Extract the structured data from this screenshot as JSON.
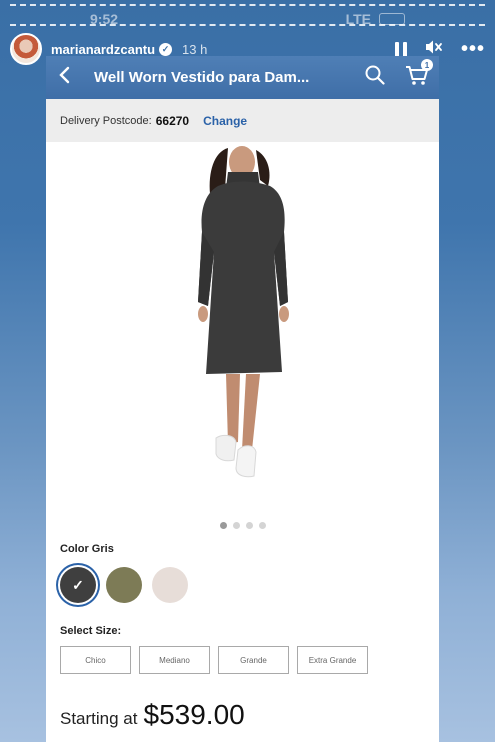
{
  "status": {
    "time": "9:52",
    "signal": "LTE"
  },
  "story": {
    "username": "marianardzcantu",
    "time_ago": "13 h"
  },
  "app": {
    "title": "Well Worn Vestido para Dam...",
    "cart_count": "1",
    "delivery_label": "Delivery Postcode:",
    "postcode": "66270",
    "change_label": "Change"
  },
  "product": {
    "image_pages": 4,
    "active_page": 1,
    "color_label": "Color",
    "color_value": "Gris",
    "colors": [
      {
        "name": "gris",
        "hex": "#3f3f3f",
        "selected": true
      },
      {
        "name": "olive",
        "hex": "#7d7b56",
        "selected": false
      },
      {
        "name": "beige",
        "hex": "#e7ddd8",
        "selected": false
      }
    ],
    "size_label": "Select Size:",
    "sizes": [
      "Chico",
      "Mediano",
      "Grande",
      "Extra Grande"
    ],
    "price_prefix": "Starting at",
    "price": "$539.00"
  },
  "colors": {
    "header": "#3f6ea7",
    "link": "#2b62a8",
    "dress": "#3b3b3b"
  }
}
